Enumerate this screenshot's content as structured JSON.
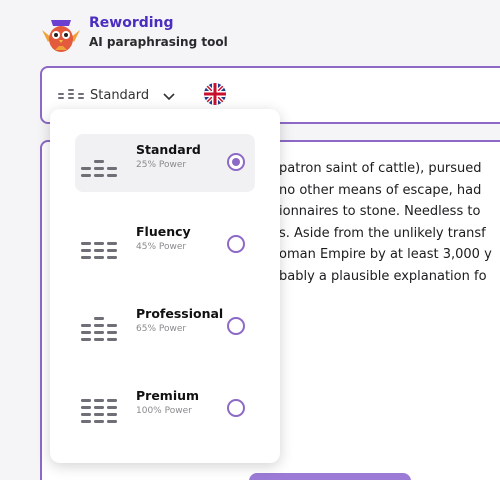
{
  "brand": {
    "title": "Rewording",
    "subtitle": "AI paraphrasing tool"
  },
  "toolbar": {
    "mode_label": "Standard",
    "language_flag": "uk-flag-icon"
  },
  "editor": {
    "lines": [
      " patron saint of cattle), pursued",
      "no other means of escape, had",
      "ionnaires to stone. Needless to",
      "s. Aside from the unlikely transf",
      "oman Empire by at least 3,000 y",
      "bably a plausible explanation fo"
    ]
  },
  "modes": [
    {
      "name": "Standard",
      "power": "25% Power",
      "selected": true,
      "level": 1
    },
    {
      "name": "Fluency",
      "power": "45% Power",
      "selected": false,
      "level": 2
    },
    {
      "name": "Professional",
      "power": "65% Power",
      "selected": false,
      "level": 3
    },
    {
      "name": "Premium",
      "power": "100% Power",
      "selected": false,
      "level": 4
    }
  ],
  "colors": {
    "accent": "#8c69c7",
    "brand": "#4b2dbf",
    "bars": "#6f6f78"
  }
}
